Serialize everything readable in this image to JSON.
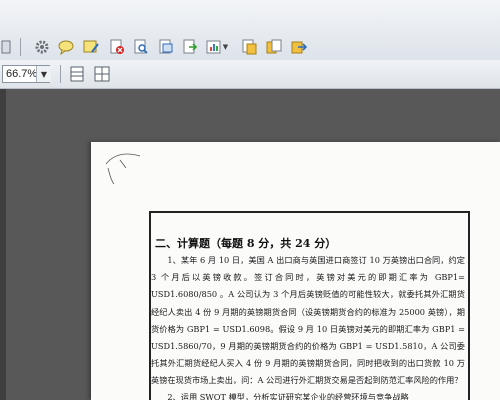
{
  "toolbar": {
    "icons": [
      "gear-icon",
      "comment-icon",
      "sticky-note-icon",
      "delete-icon",
      "find-icon",
      "fit-page-icon",
      "copy-icon",
      "chart-icon",
      "stamp-icon",
      "copy-page-icon",
      "move-page-icon",
      "share-page-icon"
    ]
  },
  "view": {
    "zoom": "66.7%"
  },
  "document": {
    "section_title": "二、计算题（每题 8 分，共 24 分）",
    "question_1": "1、某年 6 月 10 日，美国 A 出口商与英国进口商签订 10 万英镑出口合同，约定 3 个月后以英镑收款。签订合同时，英镑对美元的即期汇率为 GBP1= USD1.6080/850 。A 公司认为 3 个月后英镑贬值的可能性较大，就委托其外汇期货经纪人卖出 4 份 9 月期的英镑期货合同（设英镑期货合约的标准为 25000 英镑），期货价格为 GBP1 = USD1.6098。假设 9 月 10 日英镑对美元的即期汇率为 GBP1 = USD1.5860/70，9 月期的英镑期货合约的价格为 GBP1 = USD1.5810，A 公司委托其外汇期货经纪人买入 4 份 9 月期的英镑期货合同，同时把收到的出口货款 10 万英镑在现货市场上卖出，问：A 公司进行外汇期货交易是否起到防范汇率风险的作用？",
    "question_2_partial": "2、运用 SWOT 模型，分析实证研究某企业的经营环境与竞争战略"
  }
}
